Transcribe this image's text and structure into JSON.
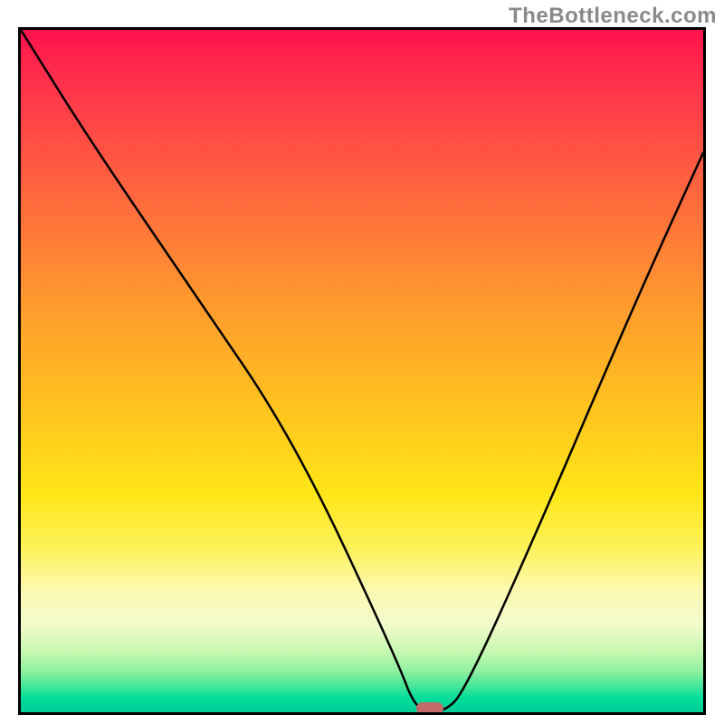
{
  "watermark": "TheBottleneck.com",
  "chart_data": {
    "type": "line",
    "title": "",
    "xlabel": "",
    "ylabel": "",
    "x_range": [
      0,
      100
    ],
    "y_range": [
      0,
      100
    ],
    "series": [
      {
        "name": "bottleneck-curve",
        "x": [
          0,
          10,
          25,
          40,
          55,
          58,
          62,
          65,
          75,
          90,
          100
        ],
        "y": [
          100,
          84,
          62,
          40,
          8,
          0,
          0,
          3,
          25,
          60,
          82
        ]
      }
    ],
    "marker": {
      "x": 60,
      "y": 0,
      "color": "#c46a6a"
    },
    "background_gradient": {
      "top": "#ff134e",
      "mid": "#ffe618",
      "bottom": "#00cc99"
    }
  }
}
